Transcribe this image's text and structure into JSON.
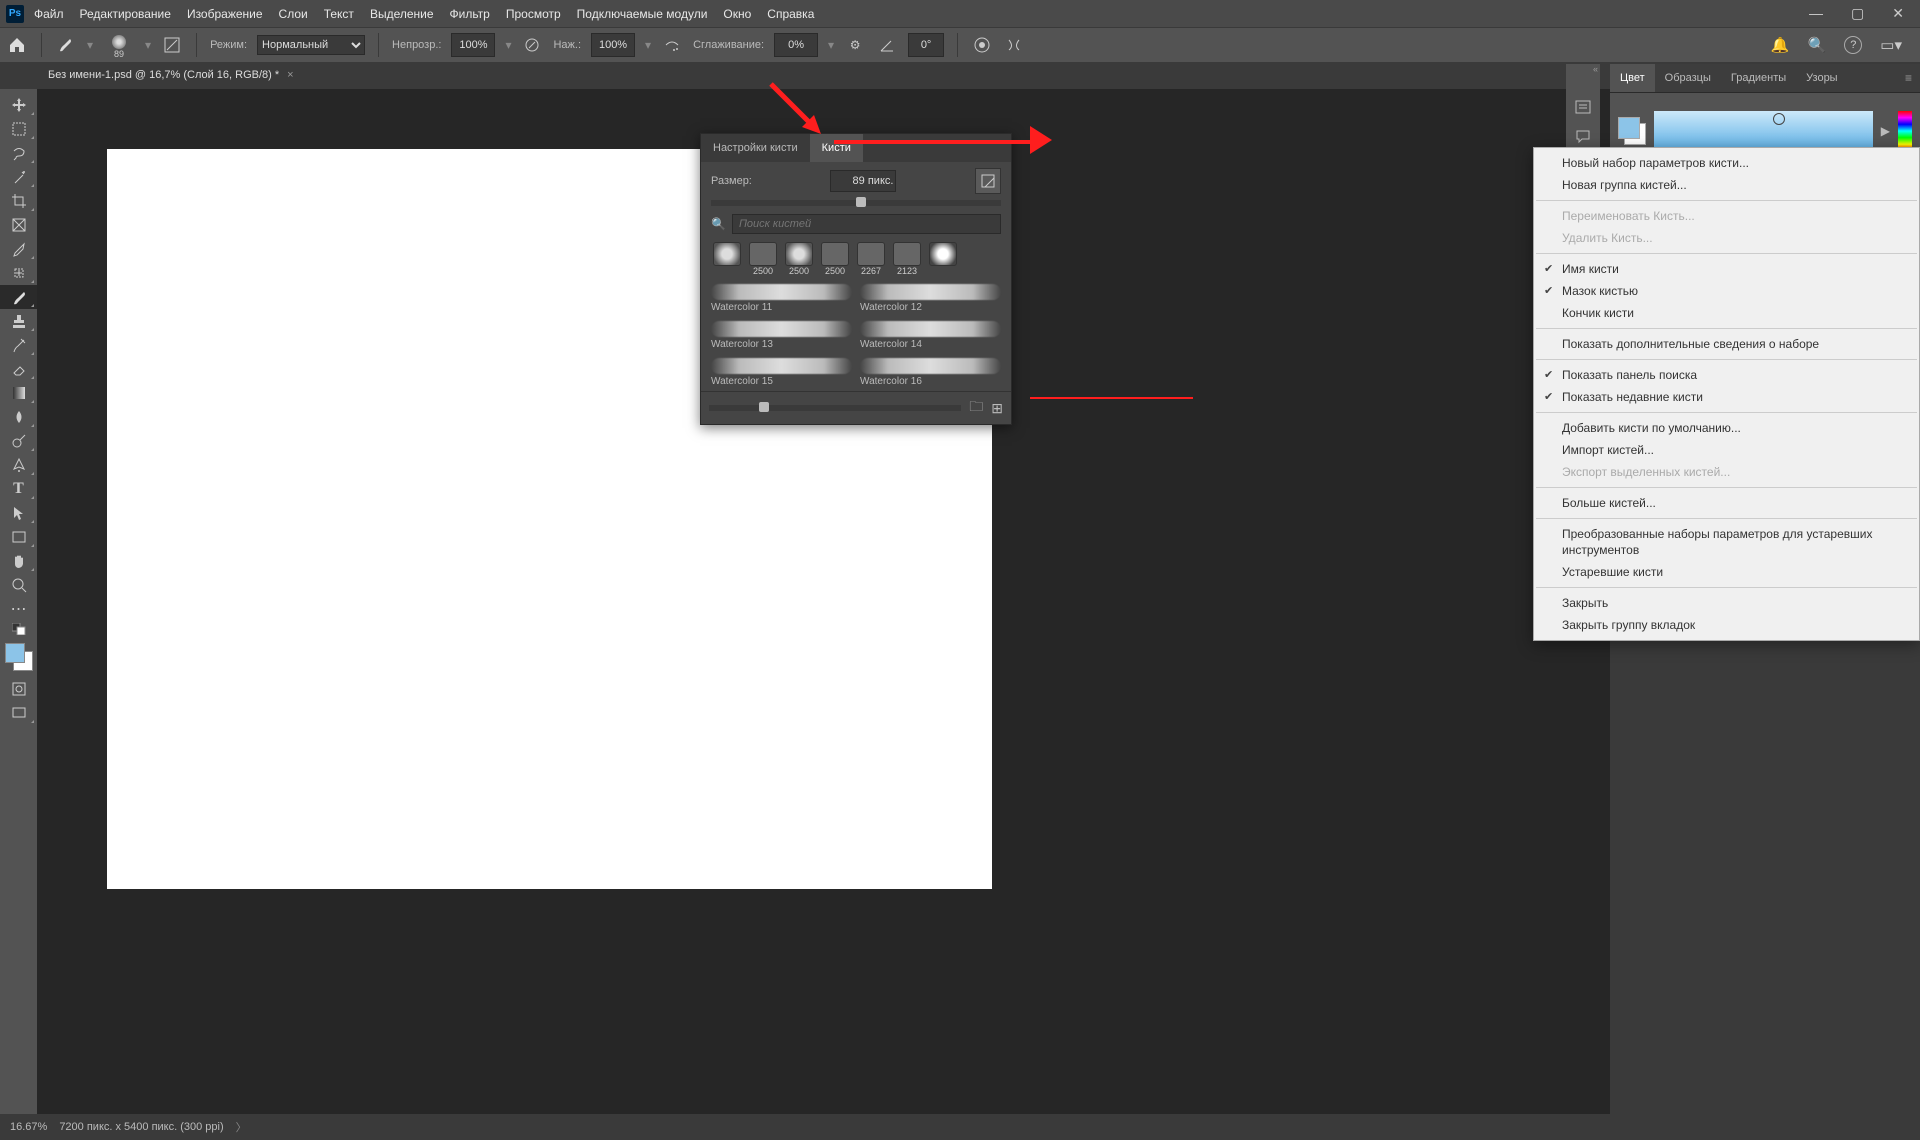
{
  "menu": {
    "items": [
      "Файл",
      "Редактирование",
      "Изображение",
      "Слои",
      "Текст",
      "Выделение",
      "Фильтр",
      "Просмотр",
      "Подключаемые модули",
      "Окно",
      "Справка"
    ]
  },
  "optbar": {
    "brush_size": "89",
    "mode_label": "Режим:",
    "mode_value": "Нормальный",
    "opacity_label": "Непрозр.:",
    "opacity_value": "100%",
    "flow_label": "Наж.:",
    "flow_value": "100%",
    "smoothing_label": "Сглаживание:",
    "smoothing_value": "0%",
    "angle_value": "0°"
  },
  "tab": {
    "title": "Без имени-1.psd @ 16,7% (Слой 16, RGB/8) *"
  },
  "right_tabs": {
    "a": "Цвет",
    "b": "Образцы",
    "c": "Градиенты",
    "d": "Узоры"
  },
  "brush_panel": {
    "tab_settings": "Настройки кисти",
    "tab_brushes": "Кисти",
    "size_label": "Размер:",
    "size_value": "89 пикс.",
    "search_ph": "Поиск кистей",
    "recent": [
      {
        "size": ""
      },
      {
        "size": "2500"
      },
      {
        "size": "2500"
      },
      {
        "size": "2500"
      },
      {
        "size": "2267"
      },
      {
        "size": "2123"
      },
      {
        "size": ""
      }
    ],
    "brushes": [
      {
        "a": "Watercolor 11",
        "b": "Watercolor 12"
      },
      {
        "a": "Watercolor 13",
        "b": "Watercolor 14"
      },
      {
        "a": "Watercolor 15",
        "b": "Watercolor 16"
      }
    ]
  },
  "ctx": {
    "new_preset": "Новый набор параметров кисти...",
    "new_group": "Новая группа кистей...",
    "rename": "Переименовать Кисть...",
    "delete": "Удалить Кисть...",
    "name": "Имя кисти",
    "stroke": "Мазок кистью",
    "tip": "Кончик кисти",
    "more_info": "Показать дополнительные сведения о наборе",
    "show_search": "Показать панель поиска",
    "show_recent": "Показать недавние кисти",
    "add_default": "Добавить кисти по умолчанию...",
    "import": "Импорт кистей...",
    "export": "Экспорт выделенных кистей...",
    "more": "Больше кистей...",
    "converted": "Преобразованные наборы параметров для устаревших инструментов",
    "legacy": "Устаревшие кисти",
    "close": "Закрыть",
    "close_group": "Закрыть группу вкладок"
  },
  "status": {
    "zoom": "16.67%",
    "dims": "7200 пикс. x 5400 пикс. (300 ppi)"
  }
}
